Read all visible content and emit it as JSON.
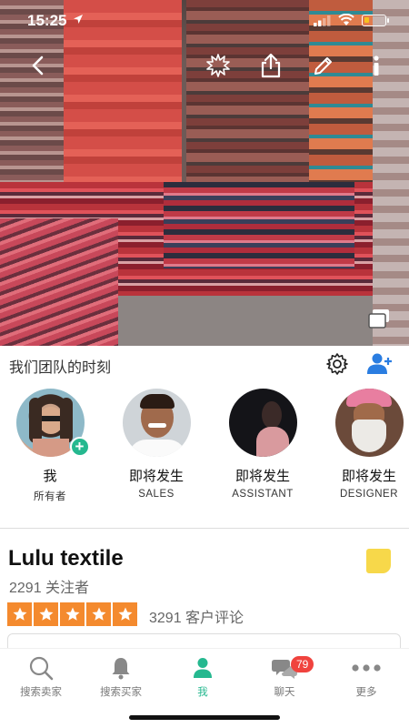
{
  "status_bar": {
    "time": "15:25"
  },
  "hero": {
    "image": "textile-shop-photo"
  },
  "team_section": {
    "title": "我们团队的时刻",
    "members": [
      {
        "name": "我",
        "role": "所有者"
      },
      {
        "name": "即将发生",
        "role": "SALES"
      },
      {
        "name": "即将发生",
        "role": "ASSISTANT"
      },
      {
        "name": "即将发生",
        "role": "DESIGNER"
      }
    ]
  },
  "store": {
    "name": "Lulu textile",
    "followers": "2291 关注者",
    "rating_stars": 5,
    "reviews": "3291 客户评论"
  },
  "tabbar": {
    "tabs": [
      {
        "label": "搜索卖家",
        "icon": "search-icon"
      },
      {
        "label": "搜索买家",
        "icon": "bell-icon"
      },
      {
        "label": "我",
        "icon": "person-icon"
      },
      {
        "label": "聊天",
        "icon": "chat-icon",
        "badge": "79"
      },
      {
        "label": "更多",
        "icon": "more-icon"
      }
    ],
    "active_index": 2
  },
  "colors": {
    "accent": "#25b88f",
    "star": "#f48a2e",
    "badge": "#f0433e",
    "link": "#2a7de1"
  }
}
